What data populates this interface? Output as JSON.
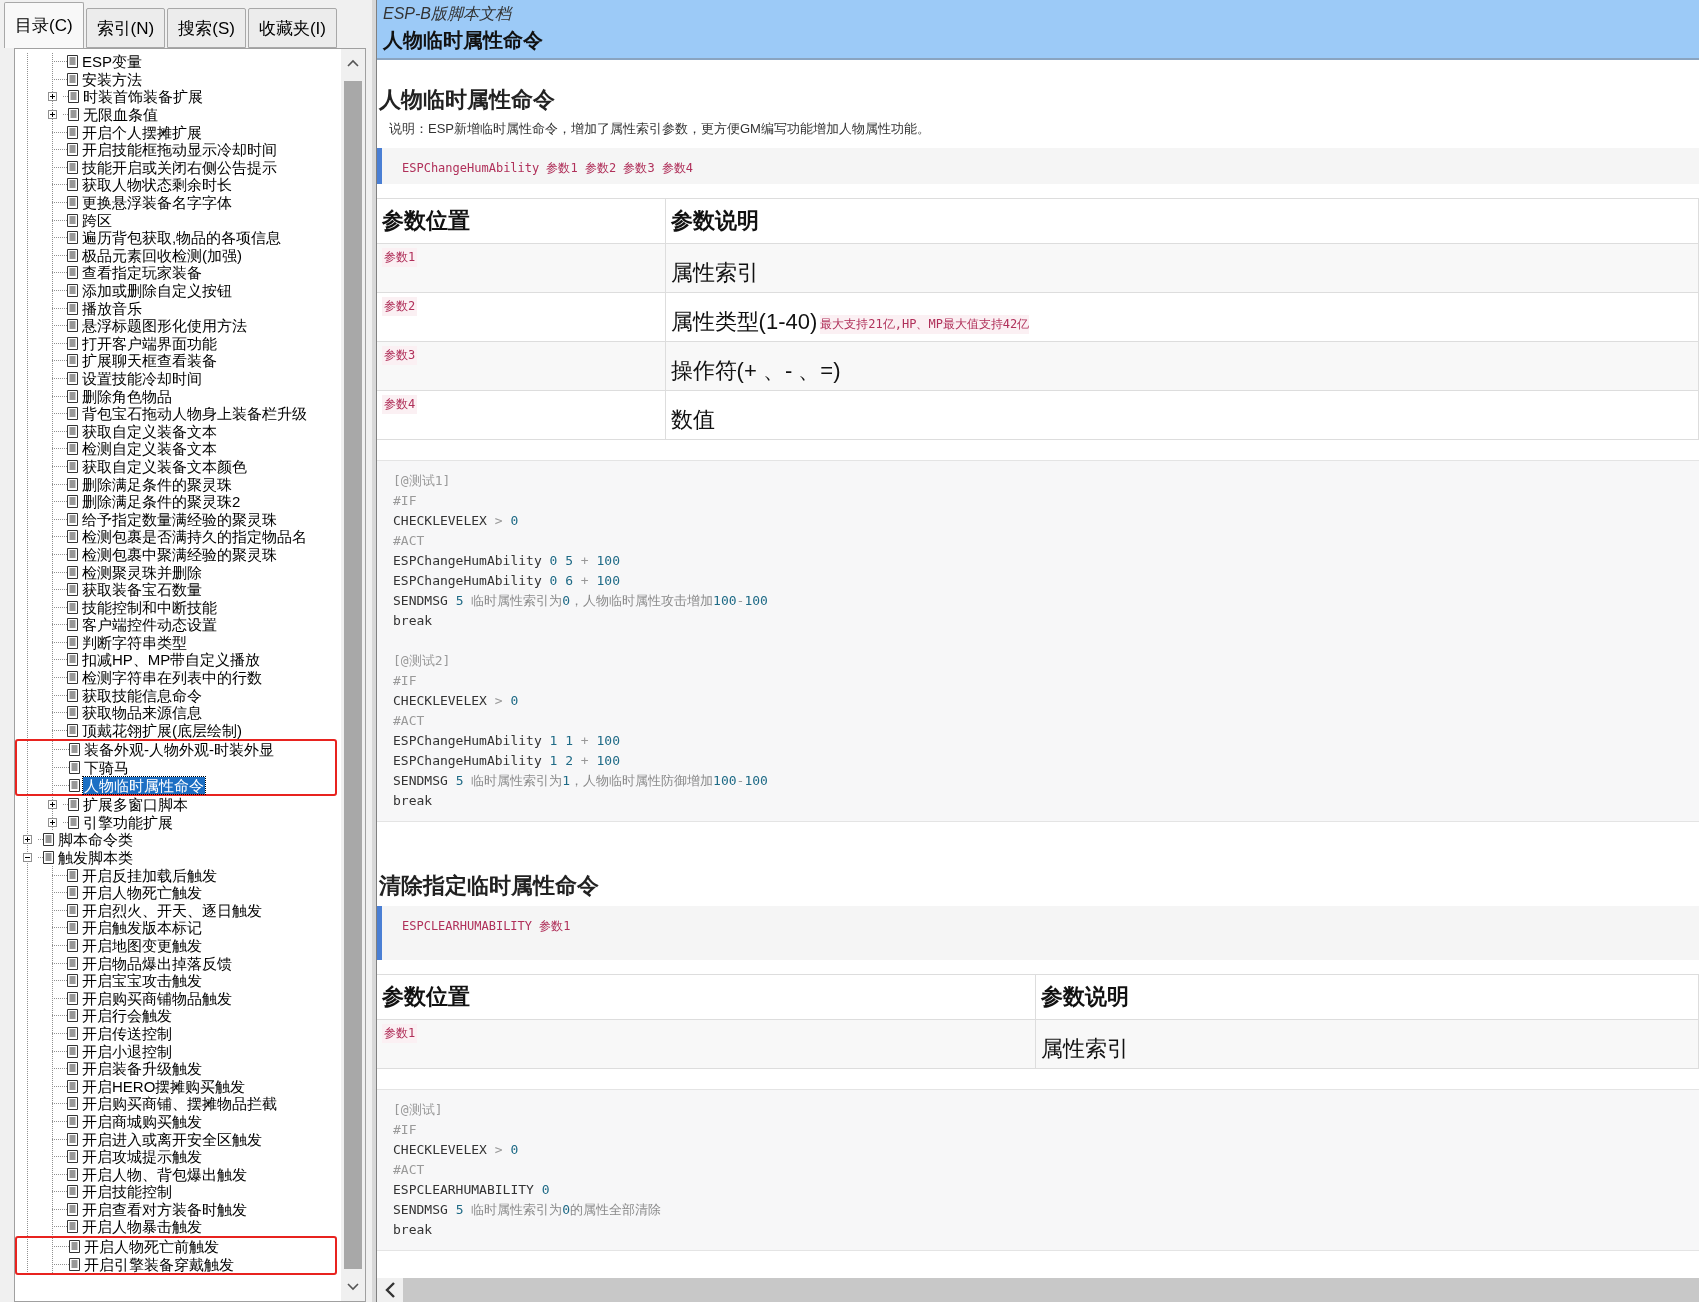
{
  "tabs": [
    {
      "label": "目录(C)",
      "selected": true
    },
    {
      "label": "索引(N)",
      "selected": false
    },
    {
      "label": "搜索(S)",
      "selected": false
    },
    {
      "label": "收藏夹(I)",
      "selected": false
    }
  ],
  "tree": {
    "items": [
      {
        "children": [
          {
            "label": "ESP变量",
            "selected": false
          },
          {
            "label": "安装方法",
            "selected": false
          },
          {
            "label": "时装首饰装备扩展",
            "selected": false,
            "expanded": false
          },
          {
            "label": "无限血条值",
            "selected": false,
            "expanded": false
          },
          {
            "label": "开启个人摆摊扩展",
            "selected": false
          },
          {
            "label": "开启技能框拖动显示冷却时间",
            "selected": false
          },
          {
            "label": "技能开启或关闭右侧公告提示",
            "selected": false
          },
          {
            "label": "获取人物状态剩余时长",
            "selected": false
          },
          {
            "label": "更换悬浮装备名字字体",
            "selected": false
          },
          {
            "label": "跨区",
            "selected": false
          },
          {
            "label": "遍历背包获取,物品的各项信息",
            "selected": false
          },
          {
            "label": "极品元素回收检测(加强)",
            "selected": false
          },
          {
            "label": "查看指定玩家装备",
            "selected": false
          },
          {
            "label": "添加或删除自定义按钮",
            "selected": false
          },
          {
            "label": "播放音乐",
            "selected": false
          },
          {
            "label": "悬浮标题图形化使用方法",
            "selected": false
          },
          {
            "label": "打开客户端界面功能",
            "selected": false
          },
          {
            "label": "扩展聊天框查看装备",
            "selected": false
          },
          {
            "label": "设置技能冷却时间",
            "selected": false
          },
          {
            "label": "删除角色物品",
            "selected": false
          },
          {
            "label": "背包宝石拖动人物身上装备栏升级",
            "selected": false
          },
          {
            "label": "获取自定义装备文本",
            "selected": false
          },
          {
            "label": "检测自定义装备文本",
            "selected": false
          },
          {
            "label": "获取自定义装备文本颜色",
            "selected": false
          },
          {
            "label": "删除满足条件的聚灵珠",
            "selected": false
          },
          {
            "label": "删除满足条件的聚灵珠2",
            "selected": false
          },
          {
            "label": "给予指定数量满经验的聚灵珠",
            "selected": false
          },
          {
            "label": "检测包裹是否满持久的指定物品名",
            "selected": false
          },
          {
            "label": "检测包裹中聚满经验的聚灵珠",
            "selected": false
          },
          {
            "label": "检测聚灵珠并删除",
            "selected": false
          },
          {
            "label": "获取装备宝石数量",
            "selected": false
          },
          {
            "label": "技能控制和中断技能",
            "selected": false
          },
          {
            "label": "客户端控件动态设置",
            "selected": false
          },
          {
            "label": "判断字符串类型",
            "selected": false
          },
          {
            "label": "扣减HP、MP带自定义播放",
            "selected": false
          },
          {
            "label": "检测字符串在列表中的行数",
            "selected": false
          },
          {
            "label": "获取技能信息命令",
            "selected": false
          },
          {
            "label": "获取物品来源信息",
            "selected": false
          },
          {
            "label": "顶戴花翎扩展(底层绘制)",
            "selected": false
          },
          {
            "kind": "highlight",
            "items": [
              {
                "label": "装备外观-人物外观-时装外显",
                "selected": false
              },
              {
                "label": "下骑马",
                "selected": false
              },
              {
                "label": "人物临时属性命令",
                "selected": true
              }
            ]
          },
          {
            "label": "扩展多窗口脚本",
            "selected": false,
            "expanded": false
          },
          {
            "label": "引擎功能扩展",
            "selected": false,
            "expanded": false
          }
        ]
      },
      {
        "label": "脚本命令类",
        "selected": false,
        "expanded": false
      },
      {
        "label": "触发脚本类",
        "selected": false,
        "expanded": true,
        "children": [
          {
            "label": "开启反挂加载后触发",
            "selected": false
          },
          {
            "label": "开启人物死亡触发",
            "selected": false
          },
          {
            "label": "开启烈火、开天、逐日触发",
            "selected": false
          },
          {
            "label": "开启触发版本标记",
            "selected": false
          },
          {
            "label": "开启地图变更触发",
            "selected": false
          },
          {
            "label": "开启物品爆出掉落反馈",
            "selected": false
          },
          {
            "label": "开启宝宝攻击触发",
            "selected": false
          },
          {
            "label": "开启购买商铺物品触发",
            "selected": false
          },
          {
            "label": "开启行会触发",
            "selected": false
          },
          {
            "label": "开启传送控制",
            "selected": false
          },
          {
            "label": "开启小退控制",
            "selected": false
          },
          {
            "label": "开启装备升级触发",
            "selected": false
          },
          {
            "label": "开启HERO摆摊购买触发",
            "selected": false
          },
          {
            "label": "开启购买商铺、摆摊物品拦截",
            "selected": false
          },
          {
            "label": "开启商城购买触发",
            "selected": false
          },
          {
            "label": "开启进入或离开安全区触发",
            "selected": false
          },
          {
            "label": "开启攻城提示触发",
            "selected": false
          },
          {
            "label": "开启人物、背包爆出触发",
            "selected": false
          },
          {
            "label": "开启技能控制",
            "selected": false
          },
          {
            "label": "开启查看对方装备时触发",
            "selected": false
          },
          {
            "label": "开启人物暴击触发",
            "selected": false
          },
          {
            "kind": "highlight",
            "items": [
              {
                "label": "开启人物死亡前触发",
                "selected": false
              },
              {
                "label": "开启引擎装备穿戴触发",
                "selected": false
              }
            ]
          }
        ]
      }
    ]
  },
  "header": {
    "subtitle": "ESP-B版脚本文档",
    "title": "人物临时属性命令"
  },
  "sections": [
    {
      "heading": "人物临时属性命令",
      "description": "说明：ESP新增临时属性命令，增加了属性索引参数，更方便GM编写功能增加人物属性功能。",
      "syntax": "ESPChangeHumAbility 参数1 参数2 参数3 参数4",
      "table": {
        "columns": [
          "参数位置",
          "参数说明"
        ],
        "rows": [
          {
            "param": "参数1",
            "text": "属性索引"
          },
          {
            "param": "参数2",
            "text": "属性类型(1-40)",
            "note": "最大支持21亿,HP、MP最大值支持42亿"
          },
          {
            "param": "参数3",
            "text": "操作符(+ 、- 、=)"
          },
          {
            "param": "参数4",
            "text": "数值"
          }
        ]
      },
      "example": [
        [
          "[@测试1]",
          "#IF",
          "CHECKLEVELEX > 0",
          "#ACT",
          "ESPChangeHumAbility 0 5 + 100",
          "ESPChangeHumAbility 0 6 + 100",
          "SENDMSG 5 临时属性索引为0，人物临时属性攻击增加100-100",
          "break"
        ],
        [
          "[@测试2]",
          "#IF",
          "CHECKLEVELEX > 0",
          "#ACT",
          "ESPChangeHumAbility 1 1 + 100",
          "ESPChangeHumAbility 1 2 + 100",
          "SENDMSG 5 临时属性索引为1，人物临时属性防御增加100-100",
          "break"
        ]
      ]
    },
    {
      "heading": "清除指定临时属性命令",
      "syntax": "ESPCLEARHUMABILITY 参数1",
      "table": {
        "columns": [
          "参数位置",
          "参数说明"
        ],
        "rows": [
          {
            "param": "参数1",
            "text": "属性索引"
          }
        ]
      },
      "example": [
        [
          "[@测试]",
          "#IF",
          "CHECKLEVELEX > 0",
          "#ACT",
          "ESPCLEARHUMABILITY 0",
          "SENDMSG 5 临时属性索引为0的属性全部清除",
          "break"
        ]
      ]
    }
  ]
}
